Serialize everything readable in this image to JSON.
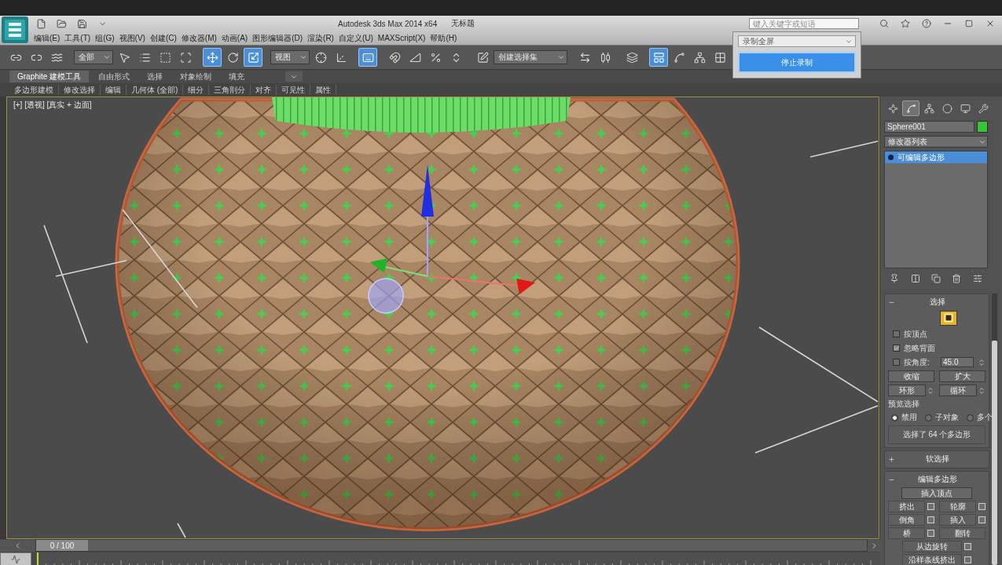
{
  "window": {
    "title": "Autodesk 3ds Max 2014 x64",
    "document": "无标题",
    "search": {
      "placeholder": "键入关键字或短语"
    }
  },
  "menu": [
    "编辑(E)",
    "工具(T)",
    "组(G)",
    "视图(V)",
    "创建(C)",
    "修改器(M)",
    "动画(A)",
    "图形编辑器(D)",
    "渲染(R)",
    "自定义(U)",
    "MAXScript(X)",
    "帮助(H)"
  ],
  "popup": {
    "dropdown": "录制全屏",
    "button": "停止录制"
  },
  "toolbar": {
    "groups": [
      {
        "items": [
          {
            "kind": "icon",
            "selected": false
          },
          {
            "kind": "icon",
            "selected": false
          },
          {
            "kind": "icon",
            "selected": false
          }
        ]
      },
      {
        "items": [
          {
            "kind": "dropdown",
            "value": "全部"
          },
          {
            "kind": "icon",
            "selected": false
          },
          {
            "kind": "icon",
            "selected": false
          },
          {
            "kind": "icon",
            "selected": false
          },
          {
            "kind": "icon",
            "selected": false
          }
        ]
      },
      {
        "items": [
          {
            "kind": "icon",
            "selected": true
          },
          {
            "kind": "icon",
            "selected": false
          },
          {
            "kind": "icon",
            "selected": true
          }
        ]
      },
      {
        "items": [
          {
            "kind": "dropdown",
            "value": "视图"
          },
          {
            "kind": "icon",
            "selected": false
          },
          {
            "kind": "icon",
            "selected": false
          }
        ]
      },
      {
        "items": [
          {
            "kind": "icon",
            "selected": true
          }
        ]
      },
      {
        "items": [
          {
            "kind": "icon",
            "selected": false
          },
          {
            "kind": "icon",
            "selected": false
          },
          {
            "kind": "icon",
            "selected": false
          },
          {
            "kind": "icon",
            "selected": false
          }
        ]
      },
      {
        "items": [
          {
            "kind": "icon",
            "selected": false
          },
          {
            "kind": "selection_set",
            "value": "创建选择集"
          }
        ]
      },
      {
        "items": [
          {
            "kind": "icon",
            "selected": false
          },
          {
            "kind": "icon",
            "selected": false
          }
        ]
      },
      {
        "items": [
          {
            "kind": "icon",
            "selected": false
          }
        ]
      },
      {
        "items": [
          {
            "kind": "icon",
            "selected": true
          },
          {
            "kind": "icon",
            "selected": false
          },
          {
            "kind": "icon",
            "selected": false
          },
          {
            "kind": "icon",
            "selected": false
          }
        ]
      }
    ]
  },
  "ribbon": {
    "tabs": [
      {
        "label": "Graphite 建模工具",
        "selected": true
      },
      {
        "label": "自由形式",
        "selected": false
      },
      {
        "label": "选择",
        "selected": false
      },
      {
        "label": "对象绘制",
        "selected": false
      },
      {
        "label": "填充",
        "selected": false
      }
    ],
    "groups": [
      "多边形建模",
      "修改选择",
      "编辑",
      "几何体 (全部)",
      "细分",
      "三角剖分",
      "对齐",
      "可见性",
      "属性"
    ]
  },
  "viewport": {
    "label": "[+] [透视] [真实 + 边面]"
  },
  "command_panel": {
    "tabs": [
      {
        "selected": false
      },
      {
        "selected": true
      },
      {
        "selected": false
      },
      {
        "selected": false
      },
      {
        "selected": false
      },
      {
        "selected": false
      }
    ],
    "object": {
      "name": "Sphere001",
      "color": "#35c43a"
    },
    "modifier_list": "修改器列表",
    "stack": [
      {
        "label": "可编辑多边形",
        "selected": true
      }
    ],
    "rollouts": [
      {
        "kind": "selection",
        "title": "选择",
        "expanded": true,
        "subobjects": [
          {
            "selected": true
          }
        ],
        "checkboxes": [
          {
            "label": "按顶点",
            "checked": false
          },
          {
            "label": "忽略背面",
            "checked": true
          },
          {
            "label": "按角度:",
            "checked": false,
            "value": "45.0"
          }
        ],
        "buttons": [
          "收缩",
          "扩大"
        ],
        "spinner_buttons": [
          "环形",
          "循环"
        ],
        "preview_label": "预览选择",
        "radios": [
          {
            "label": "禁用",
            "selected": true
          },
          {
            "label": "子对象",
            "selected": false
          },
          {
            "label": "多个",
            "selected": false
          }
        ],
        "status": "选择了 64 个多边形"
      },
      {
        "title": "软选择",
        "expanded": false
      },
      {
        "kind": "edit_polygons",
        "title": "编辑多边形",
        "expanded": true,
        "first_button": "插入顶点",
        "rows": [
          [
            {
              "label": "挤出",
              "settings": true
            },
            {
              "label": "轮廓",
              "settings": true
            }
          ],
          [
            {
              "label": "倒角",
              "settings": true
            },
            {
              "label": "插入",
              "settings": true
            }
          ],
          [
            {
              "label": "桥",
              "settings": true
            },
            {
              "label": "翻转",
              "settings": false
            }
          ],
          [
            {
              "label": "从边旋转",
              "settings": true
            }
          ],
          [
            {
              "label": "沿样条线挤出",
              "settings": true
            }
          ]
        ]
      }
    ]
  },
  "timeline": {
    "curve_editor": {
      "on": true
    },
    "slider": {
      "label": "0 / 100",
      "level": 0
    }
  }
}
